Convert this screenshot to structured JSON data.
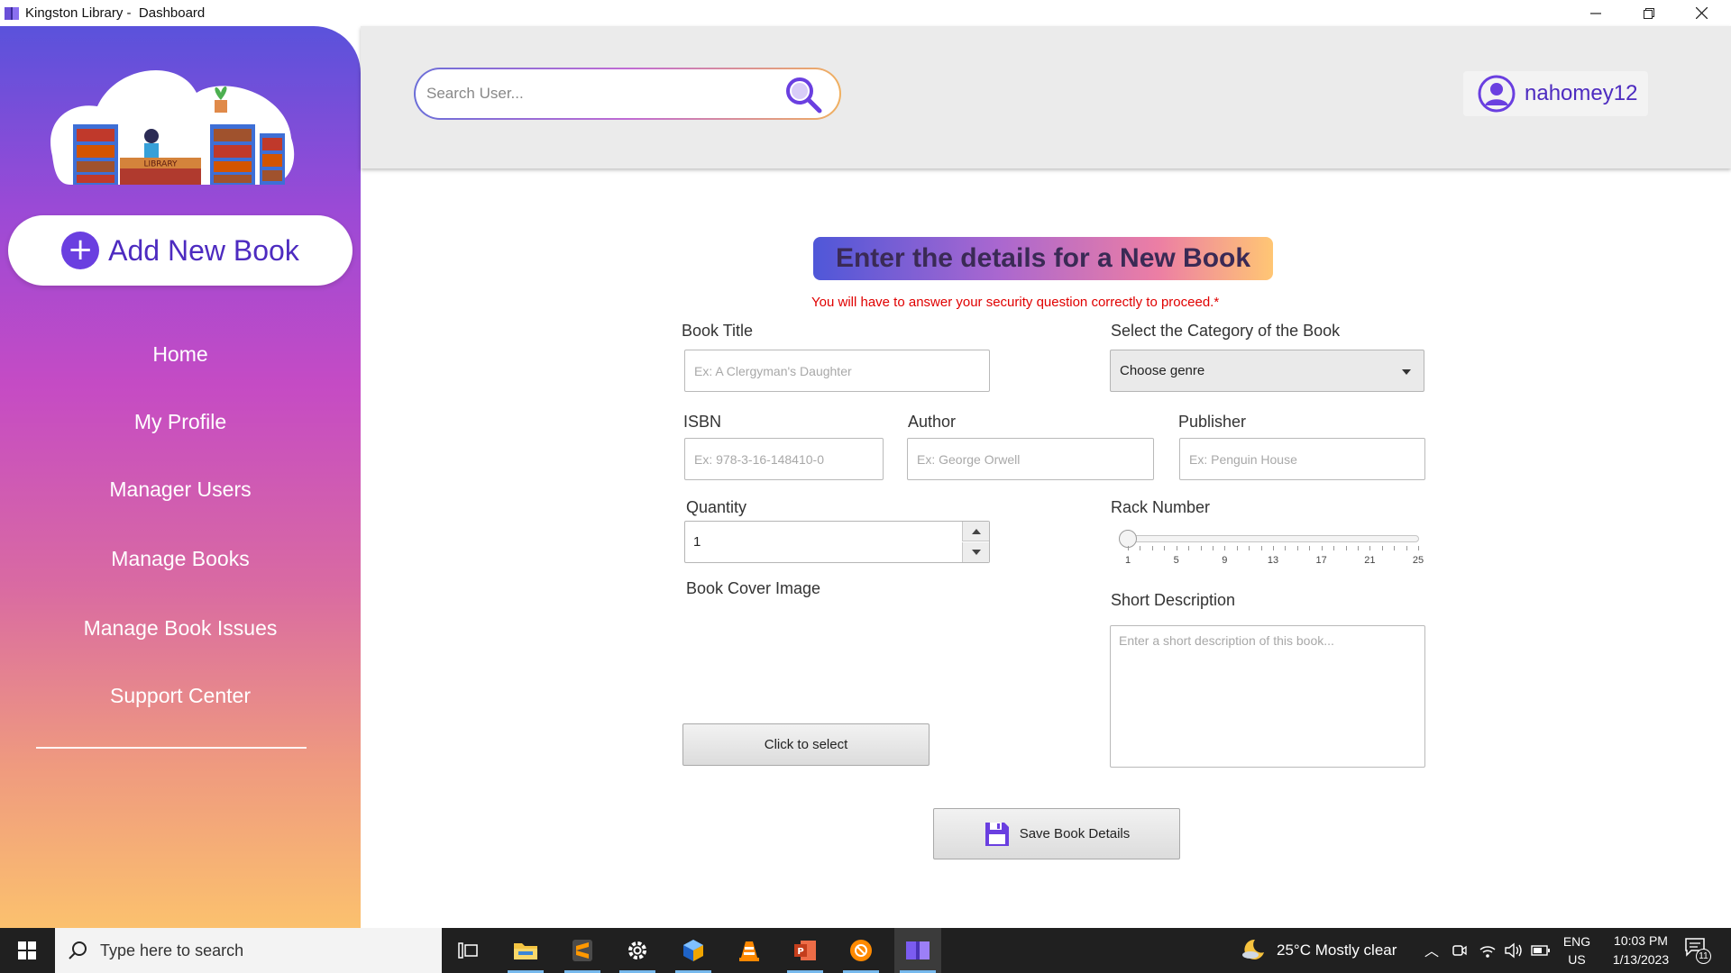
{
  "window": {
    "title": "Kingston Library -  Dashboard",
    "controls": [
      "minimize",
      "restore",
      "close"
    ]
  },
  "sidebar": {
    "add_button_label": "Add New Book",
    "logo_text": "LIBRARY",
    "items": [
      {
        "label": "Home"
      },
      {
        "label": "My Profile"
      },
      {
        "label": "Manager Users"
      },
      {
        "label": "Manage Books"
      },
      {
        "label": "Manage Book Issues"
      },
      {
        "label": "Support Center"
      }
    ]
  },
  "header": {
    "search_placeholder": "Search User...",
    "username": "nahomey12"
  },
  "form": {
    "title": "Enter the details for a New Book",
    "warning": "You will have to answer your security question correctly to proceed.*",
    "book_title": {
      "label": "Book Title",
      "placeholder": "Ex: A Clergyman's Daughter"
    },
    "category": {
      "label": "Select the Category of the Book",
      "value": "Choose genre"
    },
    "isbn": {
      "label": "ISBN",
      "placeholder": "Ex: 978-3-16-148410-0"
    },
    "author": {
      "label": "Author",
      "placeholder": "Ex: George Orwell"
    },
    "publisher": {
      "label": "Publisher",
      "placeholder": "Ex: Penguin House"
    },
    "quantity": {
      "label": "Quantity",
      "value": "1"
    },
    "rack_number": {
      "label": "Rack Number",
      "min": 1,
      "max": 25,
      "value": 1,
      "tick_labels": [
        "1",
        "5",
        "9",
        "13",
        "17",
        "21",
        "25"
      ]
    },
    "cover_image": {
      "label": "Book Cover Image",
      "button_label": "Click to select"
    },
    "description": {
      "label": "Short Description",
      "placeholder": "Enter a short description of this book..."
    },
    "save_label": "Save Book Details"
  },
  "taskbar": {
    "search_placeholder": "Type here to search",
    "weather": "25°C  Mostly clear",
    "language_top": "ENG",
    "language_bottom": "US",
    "time": "10:03 PM",
    "date": "1/13/2023",
    "notification_count": "11",
    "apps": [
      "task-view",
      "file-explorer",
      "sublime-text",
      "settings",
      "virtualbox",
      "vlc",
      "powerpoint",
      "brave",
      "library-app"
    ]
  },
  "colors": {
    "accent": "#4d2bc0",
    "warning": "#e00000",
    "taskbar": "#202020"
  }
}
